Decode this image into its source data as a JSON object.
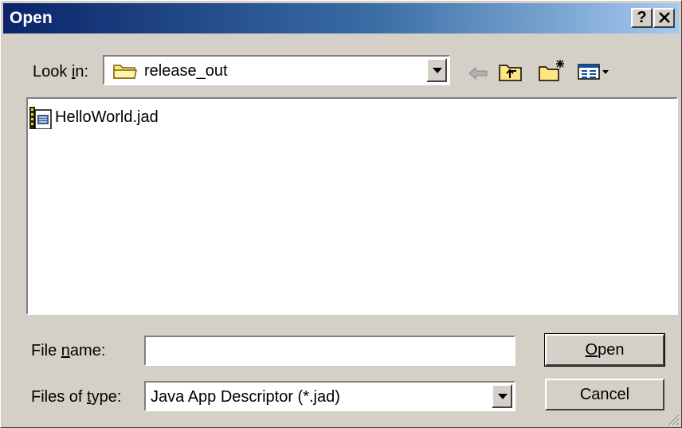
{
  "window": {
    "title": "Open",
    "help_label": "?",
    "close_label": "✕"
  },
  "look_in": {
    "label_pre": "Look ",
    "label_accel": "i",
    "label_post": "n:",
    "value": "release_out",
    "icon": "folder-icon"
  },
  "toolbar": {
    "icons": [
      "back-arrow-icon",
      "up-one-level-icon",
      "create-new-folder-icon",
      "view-menu-icon"
    ]
  },
  "files": [
    {
      "name": "HelloWorld.jad",
      "icon": "jad-file-icon"
    }
  ],
  "file_name": {
    "label_pre": "File ",
    "label_accel": "n",
    "label_post": "ame:",
    "value": "",
    "placeholder": ""
  },
  "file_type": {
    "label_pre": "Files of ",
    "label_accel": "t",
    "label_post": "ype:",
    "value": "Java App Descriptor (*.jad)"
  },
  "buttons": {
    "open_accel": "O",
    "open_rest": "pen",
    "cancel": "Cancel"
  }
}
